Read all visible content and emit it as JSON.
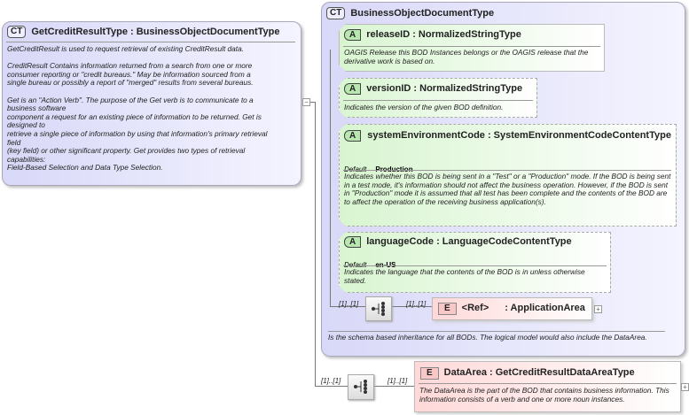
{
  "root": {
    "badge": "CT",
    "title": "GetCreditResultType : BusinessObjectDocumentType",
    "description": [
      "GetCreditResult is used to request retrieval of existing CreditResult data.",
      "",
      "CreditResult  Contains information returned from a search from one or more",
      "consumer reporting or \"credit bureaus.\" May be information sourced from a",
      "single bureau or possibly a report of \"merged\" results from several bureaus.",
      "",
      "Get is an \"Action Verb\". The purpose of the Get verb is to communicate to a",
      "business software",
      "component a request for an existing piece of information to be returned. Get is",
      "designed to",
      "retrieve a single piece of information by using that information's primary retrieval",
      "field",
      "(key field) or other significant property. Get provides two types of retrieval",
      "capabilities:",
      "Field-Based Selection and Data Type Selection."
    ]
  },
  "base": {
    "badge": "CT",
    "title": "BusinessObjectDocumentType",
    "description": "Is the schema based inheritance for all BODs. The logical model would also include the DataArea."
  },
  "attributes": [
    {
      "badge": "A",
      "title": "releaseID : NormalizedStringType",
      "description": "OAGIS Release this BOD Instances belongs or the OAGIS release that the derivative work is based on."
    },
    {
      "badge": "A",
      "title": "versionID : NormalizedStringType",
      "description": "Indicates the version of the given BOD definition."
    },
    {
      "badge": "A",
      "title": "systemEnvironmentCode : SystemEnvironmentCodeContentType",
      "default_label": "Default",
      "default_value": "Production",
      "description": "Indicates whether this BOD is being sent in a \"Test\" or a \"Production\" mode. If the BOD is being sent in a test mode, it's information should not affect the business operation. However, if the BOD is sent in \"Production\" mode it is assumed that all test has been complete and the contents of the BOD are to affect the operation of the receiving business application(s)."
    },
    {
      "badge": "A",
      "title": "languageCode : LanguageCodeContentType",
      "default_label": "Default",
      "default_value": "en-US",
      "description": "Indicates the language that the contents of the BOD is in unless otherwise stated."
    }
  ],
  "appArea": {
    "card_seq": "[1]..[1]",
    "card_elem": "[1]..[1]",
    "badge": "E",
    "ref": "<Ref>",
    "title": ": ApplicationArea"
  },
  "dataArea": {
    "card_seq": "[1]..[1]",
    "card_elem": "[1]..[1]",
    "badge": "E",
    "title": "DataArea : GetCreditResultDataAreaType",
    "description": "The DataArea is the part of the BOD that contains business information. This information consists of a verb and one or more noun instances."
  }
}
